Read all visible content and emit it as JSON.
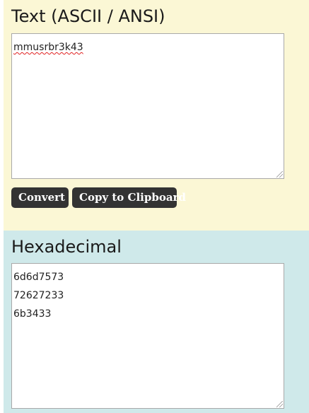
{
  "text_panel": {
    "title": "Text (ASCII / ANSI)",
    "input_value": "mmusrbr3k43"
  },
  "buttons": {
    "convert_label": "Convert",
    "copy_label": "Copy to Clipboard"
  },
  "hex_panel": {
    "title": "Hexadecimal",
    "output_lines": [
      "6d6d7573",
      "72627233",
      "6b3433"
    ]
  },
  "colors": {
    "text_panel_bg": "#fbf7d5",
    "hex_panel_bg": "#cfe9ea",
    "button_bg": "#333333",
    "button_text": "#ffffff"
  }
}
